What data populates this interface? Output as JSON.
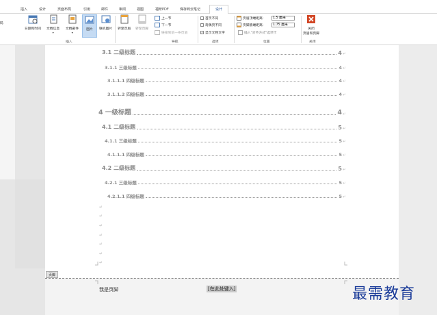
{
  "tabs": [
    "插入",
    "设计",
    "页面布局",
    "引用",
    "邮件",
    "审阅",
    "视图",
    "福昕PDF",
    "保存到云笔记",
    "设计"
  ],
  "ribbon": {
    "left_edge_label": "码",
    "insert": {
      "datetime": "日期和时间",
      "docinfo": "文档信息",
      "docparts": "文档部件",
      "picture": "图片",
      "online_picture": "联机图片",
      "group": "插入"
    },
    "navigation": {
      "goto_header": "转至页眉",
      "goto_footer": "转至页脚",
      "previous": "上一节",
      "next": "下一节",
      "link_previous": "链接到前一条页眉",
      "group": "导航"
    },
    "options": {
      "first_page": "首页不同",
      "odd_even": "奇偶页不同",
      "show_text": "显示文档文字",
      "group": "选项"
    },
    "position": {
      "header_top_label": "页眉顶端距离:",
      "header_top_value": "1.5 厘米",
      "footer_bottom_label": "页脚底端距离:",
      "footer_bottom_value": "1.75 厘米",
      "insert_tab": "插入\"对齐方式\"选项卡",
      "group": "位置"
    },
    "close": {
      "label1": "关闭",
      "label2": "页眉和页脚",
      "group": "关闭"
    }
  },
  "toc": [
    {
      "text": "3.1  二级标题",
      "page": "4"
    },
    {
      "text": "3.1.1  三级标题",
      "page": "4"
    },
    {
      "text": "3.1.1.1  四级标题",
      "page": "4"
    },
    {
      "text": "3.1.1.2  四级标题",
      "page": "4"
    },
    {
      "text": "4  一级标题",
      "page": "4"
    },
    {
      "text": "4.1  二级标题",
      "page": "5"
    },
    {
      "text": "4.1.1  三级标题",
      "page": "5"
    },
    {
      "text": "4.1.1.1  四级标题",
      "page": "5"
    },
    {
      "text": "4.2  二级标题",
      "page": "5"
    },
    {
      "text": "4.2.1  三级标题",
      "page": "5"
    },
    {
      "text": "4.2.1.1  四级标题",
      "page": "5"
    }
  ],
  "para_mark": "↵",
  "return_mark": "↵",
  "footer": {
    "tag": "页脚",
    "text": "我是页脚",
    "input": "[在此处键入]"
  },
  "watermark": "最需教育"
}
